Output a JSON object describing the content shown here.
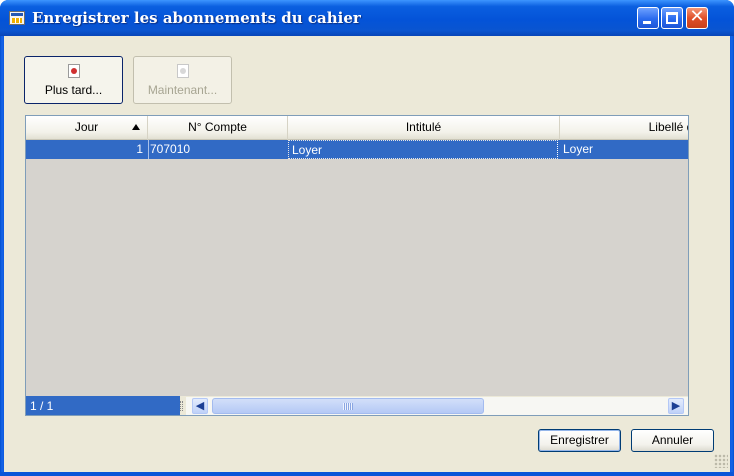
{
  "window": {
    "title": "Enregistrer les abonnements du cahier",
    "icon": "notebook-icon",
    "controls": {
      "minimize": "minimize-icon",
      "maximize": "maximize-icon",
      "close": "close-icon",
      "close_glyph": "✕"
    }
  },
  "toolbar": {
    "later_label": "Plus tard...",
    "now_label": "Maintenant...",
    "later_icon": "postpone-icon",
    "now_icon": "document-icon"
  },
  "grid": {
    "columns": [
      "Jour",
      "N° Compte",
      "Intitulé",
      "Libellé de"
    ],
    "sort_column": "Jour",
    "rows": [
      {
        "jour": "1",
        "compte": "707010",
        "intitule": "Loyer",
        "libelle": "Loyer"
      }
    ],
    "pager": "1 / 1"
  },
  "actions": {
    "save_label": "Enregistrer",
    "cancel_label": "Annuler"
  },
  "colors": {
    "titlebar": "#0453d8",
    "selection": "#316ac5",
    "client_bg": "#ece9d8"
  }
}
